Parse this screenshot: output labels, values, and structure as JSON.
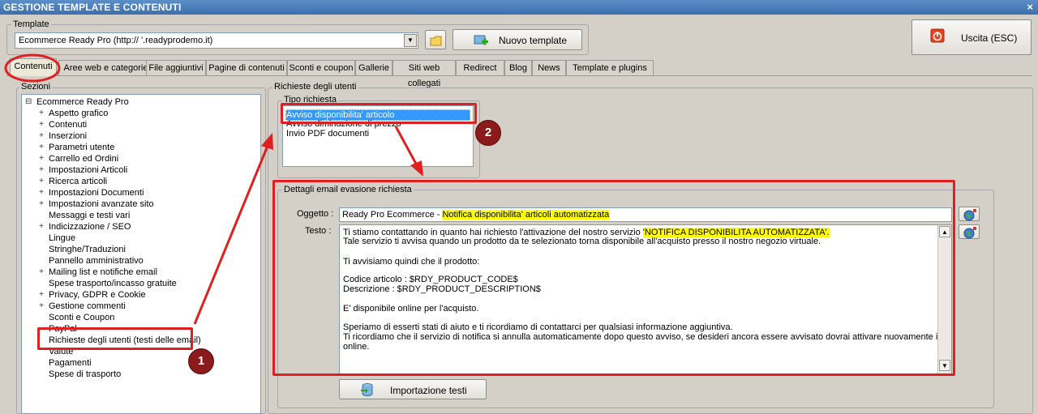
{
  "window": {
    "title": "GESTIONE TEMPLATE E CONTENUTI",
    "close": "×"
  },
  "template": {
    "group_label": "Template",
    "selected": "Ecommerce Ready Pro (http://     '.readyprodemo.it)",
    "new_button": "Nuovo template",
    "exit_button": "Uscita (ESC)"
  },
  "tabs": [
    {
      "label": "Contenuti"
    },
    {
      "label": "Aree web e categorie"
    },
    {
      "label": "File aggiuntivi"
    },
    {
      "label": "Pagine di contenuti"
    },
    {
      "label": "Sconti e coupon"
    },
    {
      "label": "Gallerie"
    },
    {
      "label": "Siti web collegati"
    },
    {
      "label": "Redirect"
    },
    {
      "label": "Blog"
    },
    {
      "label": "News"
    },
    {
      "label": "Template e plugins"
    }
  ],
  "sections": {
    "label": "Sezioni",
    "root": "Ecommerce Ready Pro",
    "items": [
      {
        "label": "Aspetto grafico",
        "exp": "+"
      },
      {
        "label": "Contenuti",
        "exp": "+"
      },
      {
        "label": "Inserzioni",
        "exp": "+"
      },
      {
        "label": "Parametri utente",
        "exp": "+"
      },
      {
        "label": "Carrello ed Ordini",
        "exp": "+"
      },
      {
        "label": "Impostazioni Articoli",
        "exp": "+"
      },
      {
        "label": "Ricerca articoli",
        "exp": "+"
      },
      {
        "label": "Impostazioni Documenti",
        "exp": "+"
      },
      {
        "label": "Impostazioni avanzate sito",
        "exp": "+"
      },
      {
        "label": "Messaggi e testi vari",
        "exp": ""
      },
      {
        "label": "Indicizzazione / SEO",
        "exp": "+"
      },
      {
        "label": "Lingue",
        "exp": ""
      },
      {
        "label": "Stringhe/Traduzioni",
        "exp": ""
      },
      {
        "label": "Pannello amministrativo",
        "exp": ""
      },
      {
        "label": "Mailing list e notifiche email",
        "exp": "+"
      },
      {
        "label": "Spese trasporto/incasso gratuite",
        "exp": ""
      },
      {
        "label": "Privacy, GDPR e Cookie",
        "exp": "+"
      },
      {
        "label": "Gestione commenti",
        "exp": "+"
      },
      {
        "label": "Sconti e Coupon",
        "exp": ""
      },
      {
        "label": "PayPal",
        "exp": ""
      },
      {
        "label": "Richieste degli utenti (testi delle email)",
        "exp": ""
      },
      {
        "label": "Valute",
        "exp": ""
      },
      {
        "label": "Pagamenti",
        "exp": ""
      },
      {
        "label": "Spese di trasporto",
        "exp": ""
      }
    ]
  },
  "requests": {
    "group_label": "Richieste degli utenti",
    "type_label": "Tipo richiesta",
    "types": [
      "Avviso disponibilita' articolo",
      "Avviso diminuzione di prezzo",
      "Invio PDF documenti"
    ],
    "details_label": "Dettagli email evasione richiesta",
    "subject_label": "Oggetto :",
    "subject_prefix": "Ready Pro Ecommerce - ",
    "subject_highlight": "Notifica disponibilita' articoli automatizzata",
    "body_label": "Testo :",
    "body": {
      "l1a": "Ti stiamo contattando in quanto hai richiesto l'attivazione del nostro servizio ",
      "l1b": "'NOTIFICA DISPONIBILITA AUTOMATIZZATA'.",
      "l2": "Tale servizio ti avvisa quando un prodotto da te selezionato torna disponibile all'acquisto presso il nostro negozio virtuale.",
      "l3": "Ti avvisiamo quindi che il prodotto:",
      "l4": "Codice articolo : $RDY_PRODUCT_CODE$",
      "l5": "Descrizione : $RDY_PRODUCT_DESCRIPTION$",
      "l6": "E' disponibile online per l'acquisto.",
      "l7": "Speriamo di esserti stati di aiuto e ti ricordiamo di contattarci per qualsiasi informazione aggiuntiva.",
      "l8": "Ti ricordiamo che il servizio di notifica si annulla automaticamente dopo questo avviso, se desideri ancora essere avvisato dovrai attivare nuovamente il servizio",
      "l9": "online."
    },
    "import_button": "Importazione testi"
  },
  "callouts": {
    "one": "1",
    "two": "2"
  },
  "colors": {
    "annotation": "#e02020",
    "badge": "#8b1a1a",
    "selection": "#3399ff",
    "highlight": "#ffff00"
  }
}
